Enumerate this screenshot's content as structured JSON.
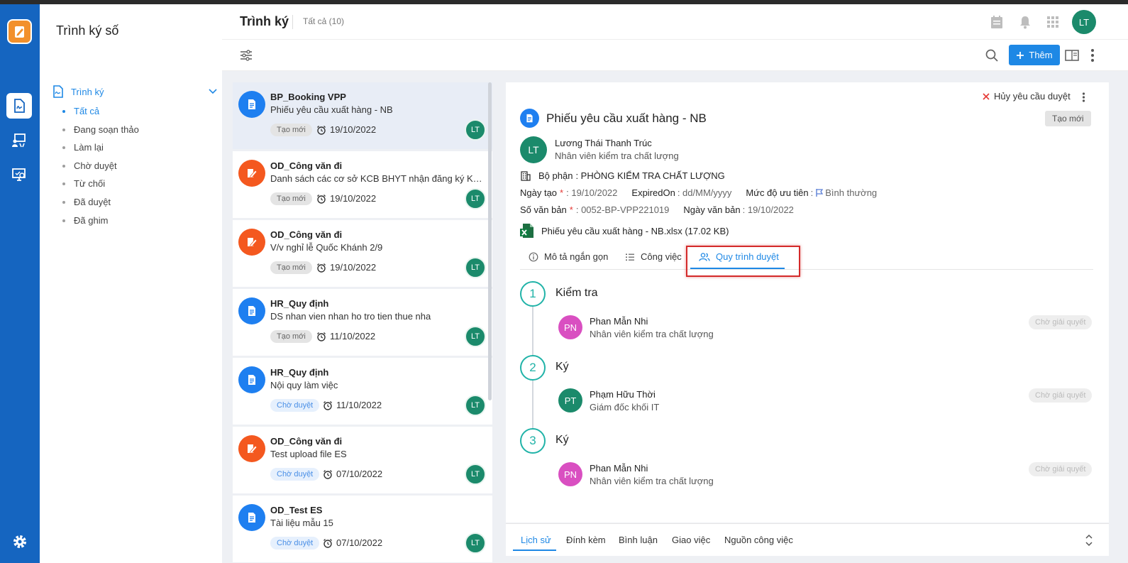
{
  "app": {
    "module_title": "Trình ký số"
  },
  "sidebar": {
    "group_label": "Trình ký",
    "items": [
      {
        "label": "Tất cả"
      },
      {
        "label": "Đang soạn thảo"
      },
      {
        "label": "Làm lại"
      },
      {
        "label": "Chờ duyệt"
      },
      {
        "label": "Từ chối"
      },
      {
        "label": "Đã duyệt"
      },
      {
        "label": "Đã ghim"
      }
    ]
  },
  "header": {
    "title": "Trình ký",
    "count": "Tất cả (10)",
    "avatar": "LT"
  },
  "toolbar": {
    "add_label": "Thêm"
  },
  "list": [
    {
      "title": "BP_Booking VPP",
      "subtitle": "Phiếu yêu cầu xuất hàng - NB",
      "badge": "Tạo mới",
      "date": "19/10/2022",
      "avatar": "LT",
      "icon": "document-icon"
    },
    {
      "title": "OD_Công văn đi",
      "subtitle": "Danh sách các cơ sở KCB BHYT nhận đăng ký KCB ban đầu",
      "badge": "Tạo mới",
      "date": "19/10/2022",
      "avatar": "LT",
      "icon": "edit-document-icon"
    },
    {
      "title": "OD_Công văn đi",
      "subtitle": "V/v nghỉ lễ Quốc Khánh 2/9",
      "badge": "Tạo mới",
      "date": "19/10/2022",
      "avatar": "LT",
      "icon": "edit-document-icon"
    },
    {
      "title": "HR_Quy định",
      "subtitle": "DS nhan vien nhan ho tro tien thue nha",
      "badge": "Tạo mới",
      "date": "11/10/2022",
      "avatar": "LT",
      "icon": "document-icon"
    },
    {
      "title": "HR_Quy định",
      "subtitle": "Nội quy làm việc",
      "badge": "Chờ duyệt",
      "date": "11/10/2022",
      "avatar": "LT",
      "icon": "document-icon"
    },
    {
      "title": "OD_Công văn đi",
      "subtitle": "Test upload file ES",
      "badge": "Chờ duyệt",
      "date": "07/10/2022",
      "avatar": "LT",
      "icon": "edit-document-icon"
    },
    {
      "title": "OD_Test ES",
      "subtitle": "Tài liệu mẫu 15",
      "badge": "Chờ duyệt",
      "date": "07/10/2022",
      "avatar": "LT",
      "icon": "document-icon"
    }
  ],
  "detail": {
    "cancel_label": "Hủy yêu cầu duyệt",
    "title": "Phiếu yêu cầu xuất hàng - NB",
    "status": "Tạo mới",
    "creator_avatar": "LT",
    "creator_name": "Lương Thái Thanh Trúc",
    "creator_role": "Nhân viên kiểm tra chất lượng",
    "dept_label": "Bộ phận",
    "dept_value": ": PHÒNG KIỂM TRA CHẤT LƯỢNG",
    "created_label": "Ngày tạo",
    "created_value": ": 19/10/2022",
    "expired_label": "ExpiredOn",
    "expired_value": ": dd/MM/yyyy",
    "priority_label": "Mức độ ưu tiên",
    "priority_colon": ":",
    "priority_value": "Bình thường",
    "docno_label": "Số văn bản",
    "docno_value": ": 0052-BP-VPP221019",
    "docdate_label": "Ngày văn bản",
    "docdate_value": ": 19/10/2022",
    "required_mark": "*",
    "file": "Phiếu yêu cầu xuất hàng - NB.xlsx (17.02 KB)",
    "tabs": [
      {
        "label": "Mô tả ngắn gọn"
      },
      {
        "label": "Công việc"
      },
      {
        "label": "Quy trình duyệt"
      }
    ],
    "steps": [
      {
        "num": "1",
        "label": "Kiểm tra",
        "avatar": "PN",
        "name": "Phan Mẫn Nhi",
        "role": "Nhân viên kiểm tra chất lượng",
        "status": "Chờ giải quyết"
      },
      {
        "num": "2",
        "label": "Ký",
        "avatar": "PT",
        "name": "Phạm Hữu Thời",
        "role": "Giám đốc khối IT",
        "status": "Chờ giải quyết"
      },
      {
        "num": "3",
        "label": "Ký",
        "avatar": "PN",
        "name": "Phan Mẫn Nhi",
        "role": "Nhân viên kiểm tra chất lượng",
        "status": "Chờ giải quyết"
      }
    ]
  },
  "bottom_tabs": [
    {
      "label": "Lịch sử"
    },
    {
      "label": "Đính kèm"
    },
    {
      "label": "Bình luận"
    },
    {
      "label": "Giao việc"
    },
    {
      "label": "Nguồn công việc"
    }
  ]
}
